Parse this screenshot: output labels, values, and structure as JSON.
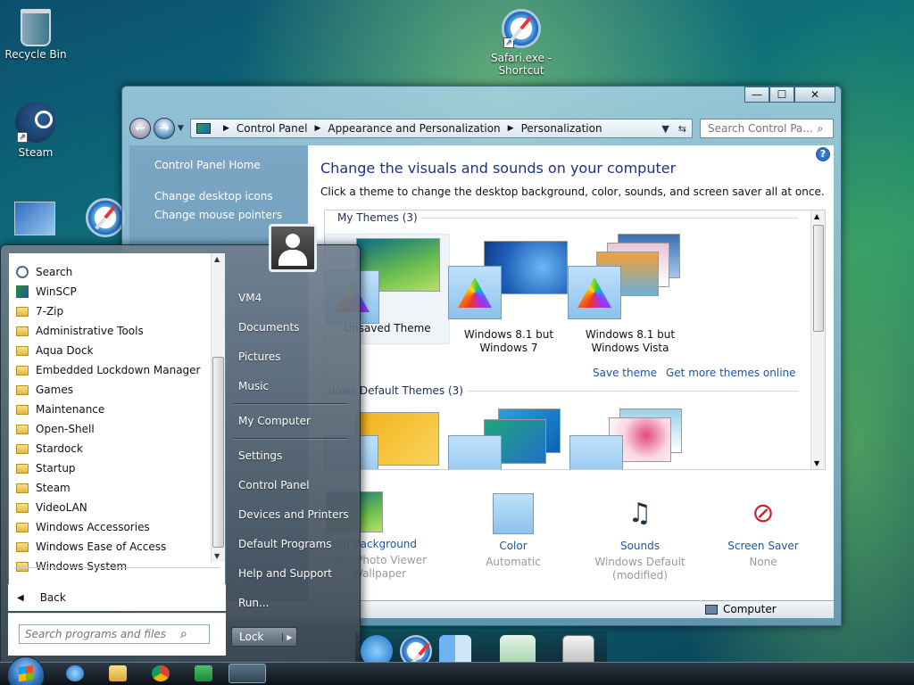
{
  "desktop": {
    "icons": [
      {
        "label": "Recycle Bin",
        "icon": "recycle-bin-icon"
      },
      {
        "label": "Steam",
        "icon": "steam-icon"
      },
      {
        "label": "Safari.exe -\nShortcut",
        "icon": "safari-icon"
      }
    ]
  },
  "window": {
    "title_buttons": {
      "minimize": "—",
      "maximize": "☐",
      "close": "✕"
    },
    "breadcrumb": [
      "Control Panel",
      "Appearance and Personalization",
      "Personalization"
    ],
    "search_placeholder": "Search Control Pa...",
    "sidebar": {
      "home": "Control Panel Home",
      "links": [
        "Change desktop icons",
        "Change mouse pointers"
      ]
    },
    "heading": "Change the visuals and sounds on your computer",
    "subheading": "Click a theme to change the desktop background, color, sounds, and screen saver all at once.",
    "my_themes_label": "My Themes (3)",
    "my_themes": [
      {
        "name": "Unsaved Theme",
        "selected": true
      },
      {
        "name": "Windows 8.1 but\nWindows 7",
        "selected": false
      },
      {
        "name": "Windows 8.1 but\nWindows Vista",
        "selected": false
      }
    ],
    "save_theme": "Save theme",
    "get_more": "Get more themes online",
    "default_themes_label": "dows Default Themes (3)",
    "bottom": [
      {
        "name": "ktop Background",
        "value": "ows Photo Viewer\nWallpaper",
        "icon": "desktop-background-icon"
      },
      {
        "name": "Color",
        "value": "Automatic",
        "icon": "color-icon"
      },
      {
        "name": "Sounds",
        "value": "Windows Default\n(modified)",
        "icon": "sounds-icon"
      },
      {
        "name": "Screen Saver",
        "value": "None",
        "icon": "screen-saver-icon"
      }
    ],
    "status": "Computer"
  },
  "start_menu": {
    "programs": [
      "Search",
      "WinSCP",
      "7-Zip",
      "Administrative Tools",
      "Aqua Dock",
      "Embedded Lockdown Manager",
      "Games",
      "Maintenance",
      "Open-Shell",
      "Stardock",
      "Startup",
      "Steam",
      "VideoLAN",
      "Windows Accessories",
      "Windows Ease of Access",
      "Windows System"
    ],
    "back": "Back",
    "search_placeholder": "Search programs and files",
    "right_items": [
      "VM4",
      "Documents",
      "Pictures",
      "Music",
      "My Computer",
      "Settings",
      "Control Panel",
      "Devices and Printers",
      "Default Programs",
      "Help and Support",
      "Run..."
    ],
    "lock": "Lock"
  },
  "colors": {
    "accent": "#1e3287",
    "link": "#1a55a3"
  }
}
